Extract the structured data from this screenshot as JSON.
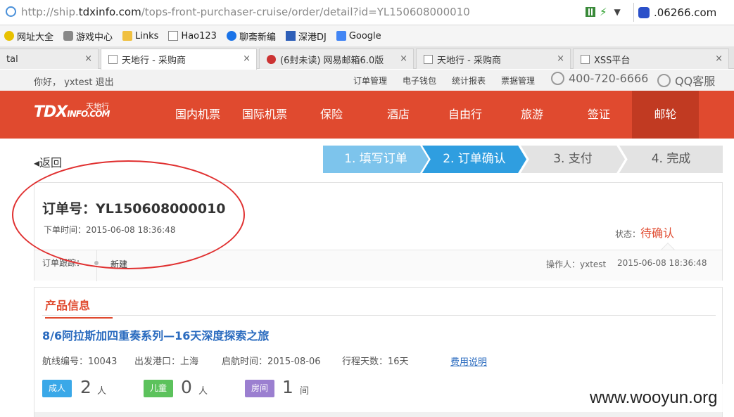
{
  "browser": {
    "url_prefix": "http://ship.",
    "url_domain": "tdxinfo.com",
    "url_path": "/tops-front-purchaser-cruise/order/detail?id=YL150608000010",
    "search_text": ".06266.com"
  },
  "bookmarks": [
    "网址大全",
    "游戏中心",
    "Links",
    "Hao123",
    "聊斋新编",
    "深港DJ",
    "Google"
  ],
  "tabs": [
    {
      "label": "tal"
    },
    {
      "label": "天地行 - 采购商"
    },
    {
      "label": "(6封未读) 网易邮箱6.0版"
    },
    {
      "label": "天地行 - 采购商"
    },
    {
      "label": "XSS平台"
    }
  ],
  "tab_close": "×",
  "site": {
    "greeting": "你好， yxtest 退出",
    "top_links": [
      "订单管理",
      "电子钱包",
      "统计报表",
      "票据管理"
    ],
    "phone": "400-720-6666",
    "qq": "QQ客服"
  },
  "nav": {
    "logo": "TDX",
    "logo_small": "INFO.COM",
    "logo_cn": "天地行",
    "items": [
      "国内机票",
      "国际机票",
      "保险",
      "酒店",
      "自由行",
      "旅游",
      "签证",
      "邮轮"
    ]
  },
  "back_label": "返回",
  "steps": [
    "1. 填写订单",
    "2. 订单确认",
    "3. 支付",
    "4. 完成"
  ],
  "order": {
    "number": "订单号：YL150608000010",
    "time": "下单时间：2015-06-08 18:36:48",
    "status_label": "状态：",
    "status_value": "待确认",
    "track_label": "订单跟踪：",
    "track_status": "新建",
    "operator": "操作人：yxtest",
    "track_time": "2015-06-08 18:36:48"
  },
  "product": {
    "section_title": "产品信息",
    "cruise_name": "8/6阿拉斯加四重奏系列—16天深度探索之旅",
    "route_no": "航线编号：10043",
    "port": "出发港口：上海",
    "depart_time": "启航时间：2015-08-06",
    "days": "行程天数：16天",
    "fee_link": "费用说明",
    "adult_label": "成人",
    "adult_count": "2",
    "adult_unit": "人",
    "child_label": "儿童",
    "child_count": "0",
    "child_unit": "人",
    "room_label": "房间",
    "room_count": "1",
    "room_unit": "间"
  },
  "watermark": "www.wooyun.org"
}
